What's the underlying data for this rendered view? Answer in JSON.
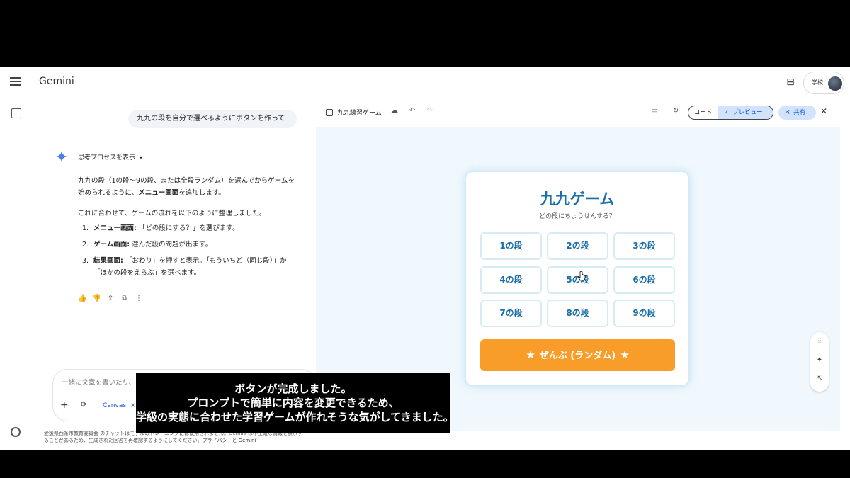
{
  "app": {
    "title": "Gemini",
    "account_label": "学校",
    "icons": {
      "menu": "menu-icon",
      "temp_chat": "temporary-chat-icon",
      "new_chat": "edit-icon",
      "settings": "gear-icon"
    }
  },
  "chat": {
    "user_message": "九九の段を自分で選べるようにボタンを作って",
    "thinking_label": "思考プロセスを表示",
    "response": {
      "p1_a": "九九の段（1の段〜9の段、または全段ランダム）を選んでからゲームを始められるように、",
      "p1_bold": "メニュー画面",
      "p1_b": "を追加します。",
      "p2": "これに合わせて、ゲームの流れを以下のように整理しました。",
      "steps": [
        {
          "num": "1.",
          "bold": "メニュー画面:",
          "text": " 「どの段にする？」を選びます。"
        },
        {
          "num": "2.",
          "bold": "ゲーム画面:",
          "text": " 選んだ段の問題が出ます。"
        },
        {
          "num": "3.",
          "bold": "結果画面:",
          "text": " 「おわり」を押すと表示。「もういちど（同じ段）」か「ほかの段をえらぶ」を選べます。"
        }
      ]
    },
    "composer": {
      "placeholder": "一緒に文章を書いたり、",
      "canvas_chip": "Canvas"
    },
    "footer_note_a": "愛媛県西条市教育委員会 のチャットはモデルのトレーニングには使用されません。Gemini は不正確な情報を表示することがあるため、生成された回答を再確認するようにしてください。",
    "footer_link": "プライバシーと Gemini"
  },
  "canvas": {
    "title": "九九練習ゲーム",
    "code_label": "コード",
    "preview_label": "プレビュー",
    "share_label": "共有",
    "game": {
      "title": "九九ゲーム",
      "subtitle": "どの段にちょうせんする？",
      "dan_buttons": [
        "1の段",
        "2の段",
        "3の段",
        "4の段",
        "5の段",
        "6の段",
        "7の段",
        "8の段",
        "9の段"
      ],
      "random_label": "ぜんぶ (ランダム)"
    }
  },
  "subtitle": {
    "line1": "ボタンが完成しました。",
    "line2": "プロンプトで簡単に内容を変更できるため、",
    "line3": "学級の実態に合わせた学習ゲームが作れそうな気がしてきました。"
  },
  "colors": {
    "accent": "#1a6fa8",
    "random_button": "#f99d2a",
    "link_blue": "#0b57d0"
  }
}
